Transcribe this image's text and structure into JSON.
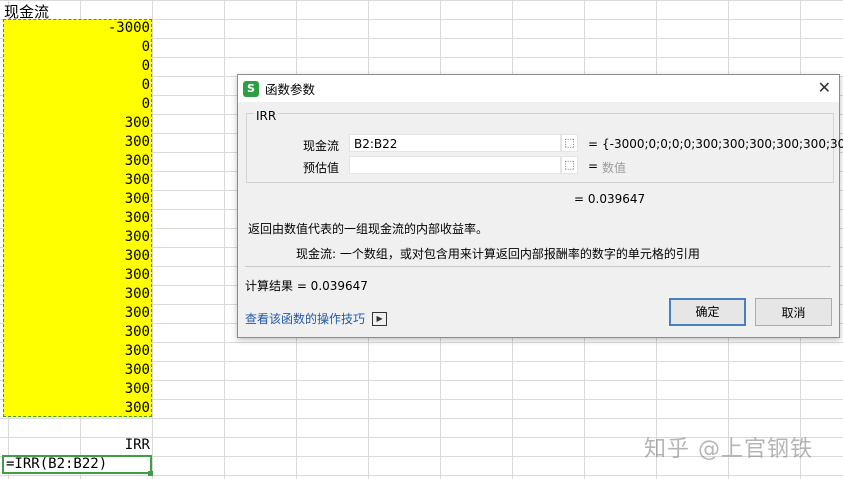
{
  "sheet": {
    "header": "现金流",
    "values": [
      "-3000",
      "0",
      "0",
      "0",
      "0",
      "300",
      "300",
      "300",
      "300",
      "300",
      "300",
      "300",
      "300",
      "300",
      "300",
      "300",
      "300",
      "300",
      "300",
      "300",
      "300"
    ],
    "irr_label": "IRR",
    "formula": "=IRR(B2:B22)"
  },
  "dialog": {
    "title": "函数参数",
    "group_title": "IRR",
    "args": [
      {
        "label": "现金流",
        "value": "B2:B22",
        "result": "{-3000;0;0;0;0;300;300;300;300;300;30..."
      },
      {
        "label": "预估值",
        "value": "",
        "result": "数值"
      }
    ],
    "equals": "=",
    "overall_result": "=  0.039647",
    "description": "返回由数值代表的一组现金流的内部收益率。",
    "arg_description": "现金流:  一个数组，或对包含用来计算返回内部报酬率的数字的单元格的引用",
    "calc_result": "计算结果  =  0.039647",
    "help_link": "查看该函数的操作技巧",
    "ok_label": "确定",
    "cancel_label": "取消",
    "icon_letter": "S",
    "close_symbol": "✕"
  },
  "watermark": "知乎 @上官钢铁"
}
